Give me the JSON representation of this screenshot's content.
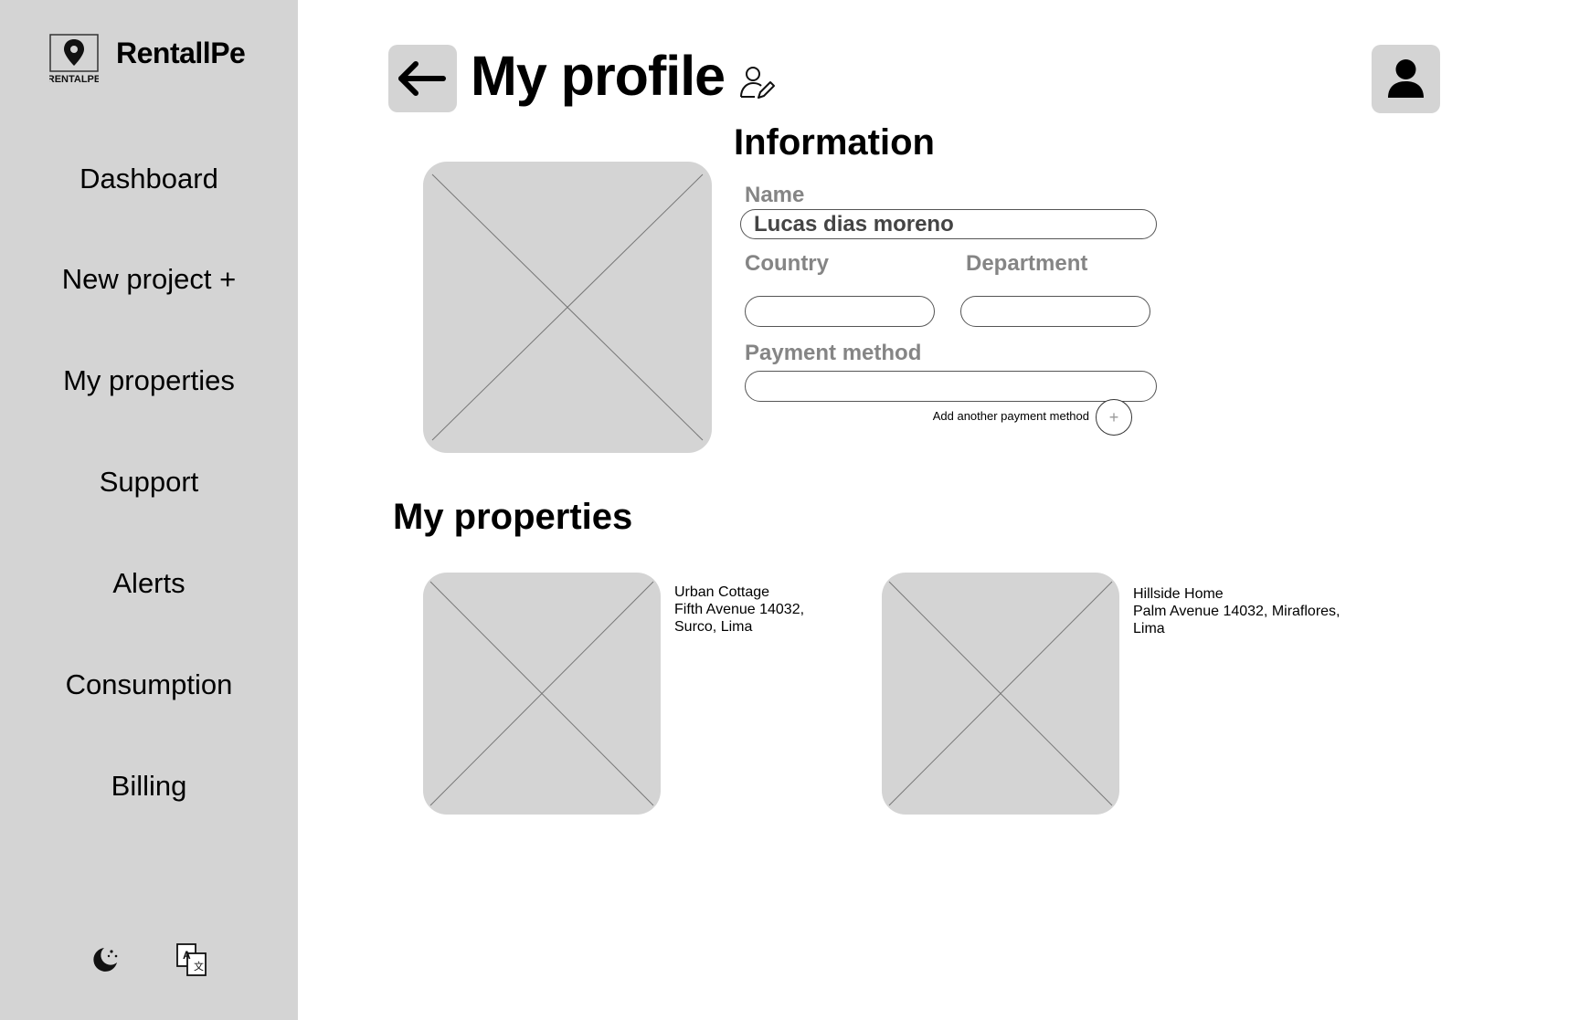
{
  "brand": {
    "name": "RentallPe",
    "logo_text": "RENTALPE"
  },
  "sidebar": {
    "items": [
      {
        "label": "Dashboard"
      },
      {
        "label": "New project +"
      },
      {
        "label": "My properties"
      },
      {
        "label": "Support"
      },
      {
        "label": "Alerts"
      },
      {
        "label": "Consumption"
      },
      {
        "label": "Billing"
      }
    ],
    "footer_icons": [
      "moon-theme-icon",
      "translate-icon"
    ]
  },
  "header": {
    "title": "My profile",
    "back_icon": "arrow-left-icon",
    "edit_icon": "user-edit-icon",
    "avatar_icon": "user-icon"
  },
  "information": {
    "heading": "Information",
    "name_label": "Name",
    "name_value": "Lucas dias moreno",
    "country_label": "Country",
    "country_value": "",
    "department_label": "Department",
    "department_value": "",
    "payment_label": "Payment method",
    "payment_value": "",
    "add_payment_label": "Add another payment method",
    "add_payment_icon": "plus-icon"
  },
  "properties": {
    "heading": "My properties",
    "items": [
      {
        "name": "Urban Cottage",
        "address_line1": "Fifth Avenue 14032,",
        "address_line2": "Surco, Lima"
      },
      {
        "name": "Hillside Home",
        "address_line1": "Palm Avenue 14032, Miraflores,",
        "address_line2": "Lima"
      }
    ]
  },
  "colors": {
    "sidebar_bg": "#d4d4d4",
    "placeholder_bg": "#d4d4d4",
    "label_gray": "#858585"
  }
}
